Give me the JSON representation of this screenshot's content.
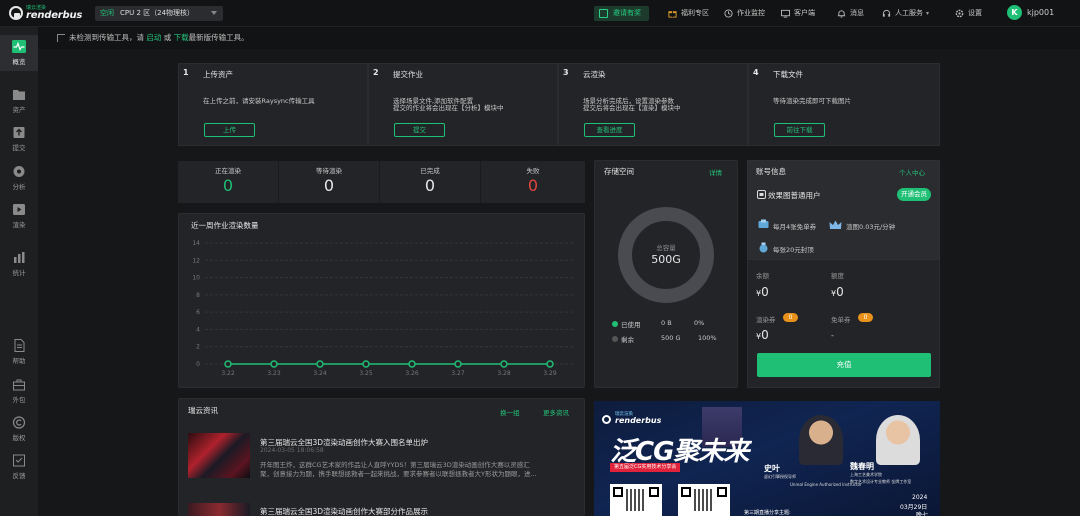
{
  "topbar": {
    "logo_small": "瑞云渲染",
    "logo_big": "renderbus",
    "zone_tag": "空闲",
    "zone_label": "CPU 2 区（24物理核）",
    "invite": "邀请有奖",
    "nav": [
      "福利专区",
      "作业监控",
      "客户端",
      "消息",
      "人工服务",
      "设置"
    ],
    "avatar_letter": "K",
    "username": "kjp001"
  },
  "sidebar": {
    "items": [
      "概览",
      "资产",
      "提交",
      "分析",
      "渲染",
      "统计",
      "帮助",
      "外包",
      "版权",
      "反馈"
    ]
  },
  "notice": {
    "pre": "未检测到传输工具，请",
    "start": "启动",
    "or": "或",
    "download": "下载",
    "post": "最新版传输工具。"
  },
  "steps": [
    {
      "num": "1",
      "title": "上传资产",
      "line1": "在上传之前，请安装Raysync传输工具",
      "line2": "",
      "button": "上传"
    },
    {
      "num": "2",
      "title": "提交作业",
      "line1": "选择场景文件,添加软件配置",
      "line2": "提交的作业将会出现在【分析】模块中",
      "button": "提交"
    },
    {
      "num": "3",
      "title": "云渲染",
      "line1": "场景分析完成后，设置渲染参数",
      "line2": "提交后将会出现在【渲染】模块中",
      "button": "查看进度"
    },
    {
      "num": "4",
      "title": "下载文件",
      "line1": "等待渲染完成即可下载图片",
      "line2": "",
      "button": "前往下载"
    }
  ],
  "stats": [
    {
      "label": "正在渲染",
      "value": "0",
      "color": "#1fbf75"
    },
    {
      "label": "等待渲染",
      "value": "0",
      "color": "#e6e6e6"
    },
    {
      "label": "已完成",
      "value": "0",
      "color": "#e6e6e6"
    },
    {
      "label": "失败",
      "value": "0",
      "color": "#e0463e"
    }
  ],
  "weekly": {
    "title": "近一周作业渲染数量"
  },
  "chart_data": {
    "type": "line",
    "title": "近一周作业渲染数量",
    "categories": [
      "3.22",
      "3.23",
      "3.24",
      "3.25",
      "3.26",
      "3.27",
      "3.28",
      "3.29"
    ],
    "values": [
      0,
      0,
      0,
      0,
      0,
      0,
      0,
      0
    ],
    "yticks": [
      "0",
      "2",
      "4",
      "6",
      "8",
      "10",
      "12",
      "14"
    ],
    "ylim": [
      0,
      14
    ],
    "grid": true,
    "color": "#1fbf75"
  },
  "storage": {
    "title": "存储空间",
    "detail": "详情",
    "donut_label": "总容量",
    "donut_value": "500G",
    "used_label": "已使用",
    "used_value": "0 B",
    "used_pct": "0%",
    "free_label": "剩余",
    "free_value": "500 G",
    "free_pct": "100%",
    "used_fraction": 0
  },
  "account": {
    "title": "账号信息",
    "personal": "个人中心",
    "user": "效果图普通用户",
    "vip_button": "开通会员",
    "perk1": "每月4张免单券",
    "perk2": "渲图0.03元/分钟",
    "perk3": "每张20元封顶",
    "balance_label": "余额",
    "balance_value": "0",
    "quota_label": "额度",
    "quota_value": "0",
    "coupon_label": "渲染券",
    "coupon_badge": "0",
    "coupon_value": "0",
    "free_label": "免单券",
    "free_badge": "0",
    "free_value": "-",
    "currency": "¥",
    "recharge": "充值"
  },
  "news": {
    "title": "瑞云资讯",
    "refresh": "换一组",
    "more": "更多资讯",
    "items": [
      {
        "title": "第三届瑞云全国3D渲染动画创作大赛入围名单出炉",
        "date": "2024-03-05 18:06:58",
        "line1": "开年图王炸，这群CG艺术家的作品让人直呼YYDS！第三届瑞云3D渲染动画创作大赛以灵感汇",
        "line2": "聚，创意接力为题，携手联想拯救者一起来挑战，要求参赛者以联想拯救者大Y形状为题眼，进..."
      },
      {
        "title": "第三届瑞云全国3D渲染动画创作大赛部分作品展示",
        "date": "",
        "line1": "",
        "line2": ""
      }
    ]
  },
  "banner": {
    "brand_small": "瑞云渲染",
    "brand": "renderbus",
    "headline": "泛CG聚未来",
    "sub": "第五届泛CG实用技术分享会",
    "person1": "史叶",
    "person1_title1": "虚幻引擎授权导师",
    "person1_title2": "Unreal Engine Authorized Instructor",
    "person2": "魏春明",
    "person2_title1": "上海工艺美术学院",
    "person2_title2": "数字艺术设计专业教师 金牌工作室",
    "year": "2024",
    "date": "03月29日",
    "time": "晚七",
    "footer": "第三期直播分享主题:"
  }
}
